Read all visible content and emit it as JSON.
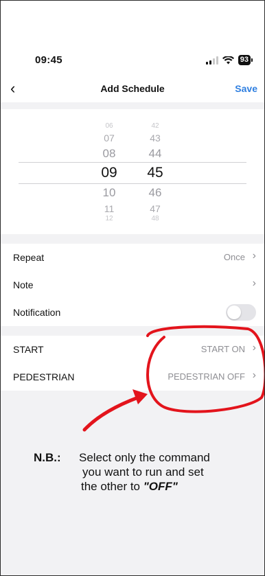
{
  "status_bar": {
    "time": "09:45",
    "battery": "93"
  },
  "nav": {
    "back_icon": "chevron-left-icon",
    "title": "Add Schedule",
    "save_label": "Save"
  },
  "picker": {
    "hours": [
      "06",
      "07",
      "08",
      "09",
      "10",
      "11",
      "12"
    ],
    "minutes": [
      "42",
      "43",
      "44",
      "45",
      "46",
      "47",
      "48"
    ],
    "selected_hour": "09",
    "selected_minute": "45"
  },
  "settings": {
    "repeat": {
      "label": "Repeat",
      "value": "Once"
    },
    "note": {
      "label": "Note",
      "value": ""
    },
    "notification": {
      "label": "Notification",
      "enabled": false
    }
  },
  "commands": {
    "start": {
      "label": "START",
      "value": "START ON"
    },
    "pedestrian": {
      "label": "PEDESTRIAN",
      "value": "PEDESTRIAN OFF"
    }
  },
  "instruction": {
    "prefix": "N.B.:",
    "line1": "Select only the command",
    "line2": "you want to run and set",
    "line3": "the other to",
    "emphasis": "\"OFF\""
  },
  "colors": {
    "accent": "#2f7fe0",
    "annotation": "#e3141c",
    "section_gap": "#f2f2f4"
  }
}
